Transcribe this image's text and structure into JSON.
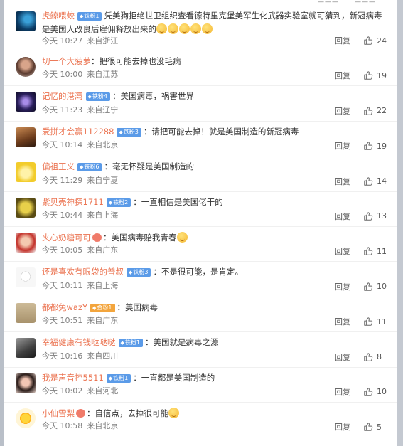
{
  "top_bar": {
    "items": [
      "———",
      "———"
    ]
  },
  "actions": {
    "reply_label": "回复"
  },
  "comments": [
    {
      "user": "虎鲸喂蛟",
      "badge": "铁粉1",
      "badge_type": "blue",
      "text": "凭美狗拒绝世卫组织查看德特里克堡美军生化武器实验室就可猜到，新冠病毒是美国人改良后雇佣释放出来的",
      "emoji_count": 5,
      "time": "今天 10:27",
      "location": "来自浙江",
      "likes": "24",
      "avatar": "dark-blue"
    },
    {
      "user": "切一个大菠萝",
      "badge": "",
      "badge_type": "",
      "text": "：把很可能去掉也没毛病",
      "time": "今天 10:00",
      "location": "来自江苏",
      "likes": "19",
      "avatar": "portrait-round"
    },
    {
      "user": "记忆的港湾",
      "badge": "铁粉4",
      "badge_type": "blue",
      "text": "：美国病毒，祸害世界",
      "time": "今天 11:23",
      "location": "来自辽宁",
      "likes": "22",
      "avatar": "night-purple"
    },
    {
      "user": "爱拼才会赢112288",
      "badge": "铁粉3",
      "badge_type": "blue",
      "text": "：请把可能去掉！就是美国制造的新冠病毒",
      "time": "今天 10:14",
      "location": "来自北京",
      "likes": "19",
      "avatar": "brown-figure"
    },
    {
      "user": "偏祖正义",
      "badge": "铁粉6",
      "badge_type": "blue",
      "text": "：毫无怀疑是美国制造的",
      "time": "今天 11:29",
      "location": "来自宁夏",
      "likes": "14",
      "avatar": "yellow-cat"
    },
    {
      "user": "紫贝壳神探1711",
      "badge": "铁粉2",
      "badge_type": "blue",
      "text": "：一直相信是美国佬干的",
      "time": "今天 10:44",
      "location": "来自上海",
      "likes": "13",
      "avatar": "yellow-king"
    },
    {
      "user": "夹心奶糖可可",
      "badge": "",
      "badge_type": "",
      "text": "：美国病毒赔我青春",
      "time": "今天 10:05",
      "location": "来自广东",
      "likes": "11",
      "avatar": "child-red",
      "heart_emoji": true,
      "tail_emoji": true
    },
    {
      "user": "还是喜欢有眼袋的普叔",
      "badge": "铁粉3",
      "badge_type": "blue",
      "text": "：不是很可能，是肯定。",
      "time": "今天 10:11",
      "location": "来自上海",
      "likes": "10",
      "avatar": "sketch-face"
    },
    {
      "user": "都都兔wazY",
      "badge": "金粉1",
      "badge_type": "gold",
      "text": "：美国病毒",
      "time": "今天 10:51",
      "location": "来自广东",
      "likes": "11",
      "avatar": "beige-sand"
    },
    {
      "user": "幸福健康有钱哒哒哒",
      "badge": "铁粉1",
      "badge_type": "blue",
      "text": "：美国就是病毒之源",
      "time": "今天 10:16",
      "location": "来自四川",
      "likes": "8",
      "avatar": "grey-photo"
    },
    {
      "user": "我是声音控5511",
      "badge": "铁粉1",
      "badge_type": "blue",
      "text": "：一直都是美国制造的",
      "time": "今天 10:02",
      "location": "来自河北",
      "likes": "10",
      "avatar": "girl-portrait"
    },
    {
      "user": "小仙雪梨",
      "badge": "",
      "badge_type": "",
      "text": "：自信点，去掉很可能",
      "time": "今天 10:58",
      "location": "来自北京",
      "likes": "5",
      "avatar": "sun-cartoon",
      "heart_emoji": true,
      "tail_emoji": true
    }
  ],
  "colors": {
    "username": "#eb7350",
    "badge_blue": "#5b9be8",
    "badge_gold": "#f3a53d",
    "meta": "#808080"
  }
}
